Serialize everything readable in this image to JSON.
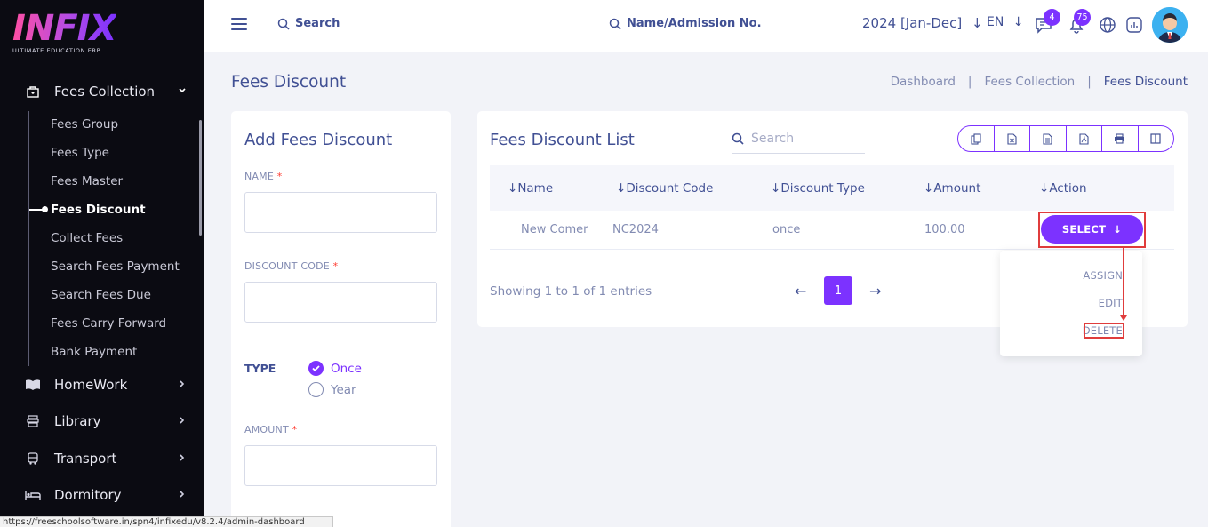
{
  "logo": {
    "word": "INFIX",
    "tagline": "ULTIMATE EDUCATION ERP"
  },
  "sidebar": {
    "active_section": "Fees Collection",
    "sub_items": [
      "Fees Group",
      "Fees Type",
      "Fees Master",
      "Fees Discount",
      "Collect Fees",
      "Search Fees Payment",
      "Search Fees Due",
      "Fees Carry Forward",
      "Bank Payment"
    ],
    "active_item": "Fees Discount",
    "sections": [
      "HomeWork",
      "Library",
      "Transport",
      "Dormitory"
    ]
  },
  "header": {
    "search_label": "Search",
    "admission_label": "Name/Admission No.",
    "year": "2024 [Jan-Dec]",
    "language": "EN",
    "chat_badge": "4",
    "notification_badge": "75"
  },
  "page": {
    "title": "Fees Discount",
    "breadcrumb": [
      "Dashboard",
      "Fees Collection",
      "Fees Discount"
    ]
  },
  "form": {
    "title": "Add Fees Discount",
    "name_label": "NAME",
    "code_label": "DISCOUNT CODE",
    "type_label": "TYPE",
    "type_options": [
      "Once",
      "Year"
    ],
    "type_selected": "Once",
    "amount_label": "AMOUNT",
    "required_mark": "*"
  },
  "list": {
    "title": "Fees Discount List",
    "search_placeholder": "Search",
    "columns": [
      "Name",
      "Discount Code",
      "Discount Type",
      "Amount",
      "Action"
    ],
    "rows": [
      {
        "name": "New Comer",
        "code": "NC2024",
        "type": "once",
        "amount": "100.00"
      }
    ],
    "select_label": "SELECT",
    "showing": "Showing 1 to 1 of 1 entries",
    "current_page": "1",
    "actions": [
      "ASSIGN",
      "EDIT",
      "DELETE"
    ]
  },
  "status_url": "https://freeschoolsoftware.in/spn4/infixedu/v8.2.4/admin-dashboard",
  "colors": {
    "accent": "#7c32ff",
    "text": "#415094",
    "muted": "#828bb2",
    "highlight": "#e03c3c"
  }
}
